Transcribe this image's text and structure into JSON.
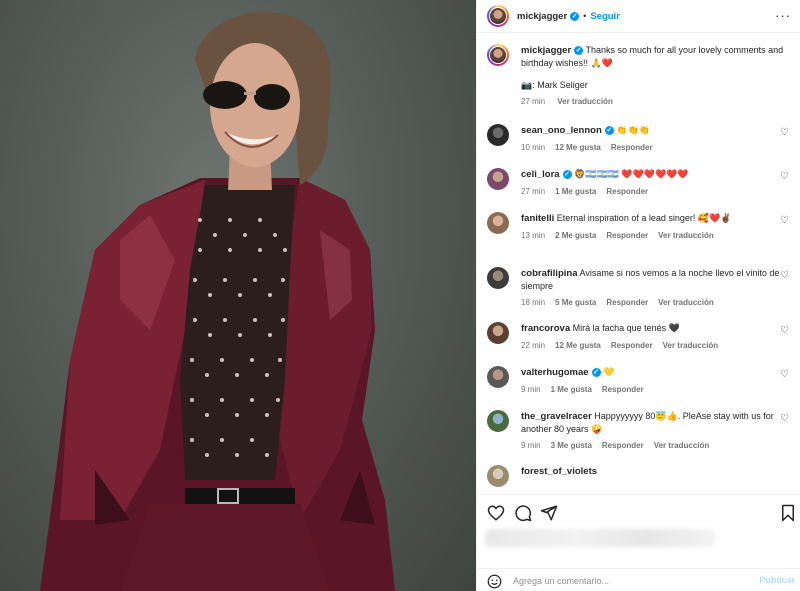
{
  "colors": {
    "accent": "#0095f6",
    "heart": "#ed4956",
    "muted": "#737373",
    "publish_disabled": "#b2dffc"
  },
  "header": {
    "username": "mickjagger",
    "separator": "•",
    "follow_label": "Seguir",
    "more_icon": "more-horizontal-icon",
    "more_label": "···"
  },
  "caption": {
    "username": "mickjagger",
    "text": "Thanks so much for all your lovely comments and birthday wishes!! 🙏❤️",
    "credit": "📷: Mark Seliger",
    "time": "27 min",
    "translate": "Ver traducción"
  },
  "comments": [
    {
      "username": "sean_ono_lennon",
      "verified": true,
      "text": "👏👏👏",
      "time": "10 min",
      "likes": "12 Me gusta",
      "reply": "Responder",
      "translate": ""
    },
    {
      "username": "celi_lora",
      "verified": true,
      "text": "🦁🇦🇷🇦🇷🇦🇷 ❤️❤️❤️❤️❤️❤️",
      "time": "27 min",
      "likes": "1 Me gusta",
      "reply": "Responder",
      "translate": ""
    },
    {
      "username": "fanitelli",
      "verified": false,
      "text": "Eternal inspiration of a lead singer! 🥰❤️✌🏾",
      "time": "13 min",
      "likes": "2 Me gusta",
      "reply": "Responder",
      "translate": "Ver traducción"
    },
    {
      "username": "cobrafilipina",
      "verified": false,
      "text": "Avisame si nos vemos a la noche llevo el vinito de siempre",
      "time": "18 min",
      "likes": "5 Me gusta",
      "reply": "Responder",
      "translate": "Ver traducción"
    },
    {
      "username": "francorova",
      "verified": false,
      "text": "Mirá la facha que tenés 🖤",
      "time": "22 min",
      "likes": "12 Me gusta",
      "reply": "Responder",
      "translate": "Ver traducción"
    },
    {
      "username": "valterhugomae",
      "verified": true,
      "text": "💛",
      "time": "9 min",
      "likes": "1 Me gusta",
      "reply": "Responder",
      "translate": ""
    },
    {
      "username": "the_gravelracer",
      "verified": false,
      "text": "Happyyyyyy 80😇👍. PleAse stay with us for another 80 years 🤪",
      "time": "9 min",
      "likes": "3 Me gusta",
      "reply": "Responder",
      "translate": "Ver traducción"
    },
    {
      "username": "forest_of_violets",
      "verified": false,
      "text": "",
      "time": "",
      "likes": "",
      "reply": "",
      "translate": ""
    }
  ],
  "actions": {
    "like_icon": "heart-icon",
    "comment_icon": "comment-icon",
    "share_icon": "send-icon",
    "save_icon": "bookmark-icon"
  },
  "compose": {
    "emoji_icon": "smiley-icon",
    "placeholder": "Agrega un comentario...",
    "publish_label": "Publicar"
  },
  "icons": {
    "verified": "verified-badge-icon",
    "comment_like": "heart-outline-icon"
  },
  "glyphs": {
    "verified": "✓",
    "heart": "♡"
  }
}
